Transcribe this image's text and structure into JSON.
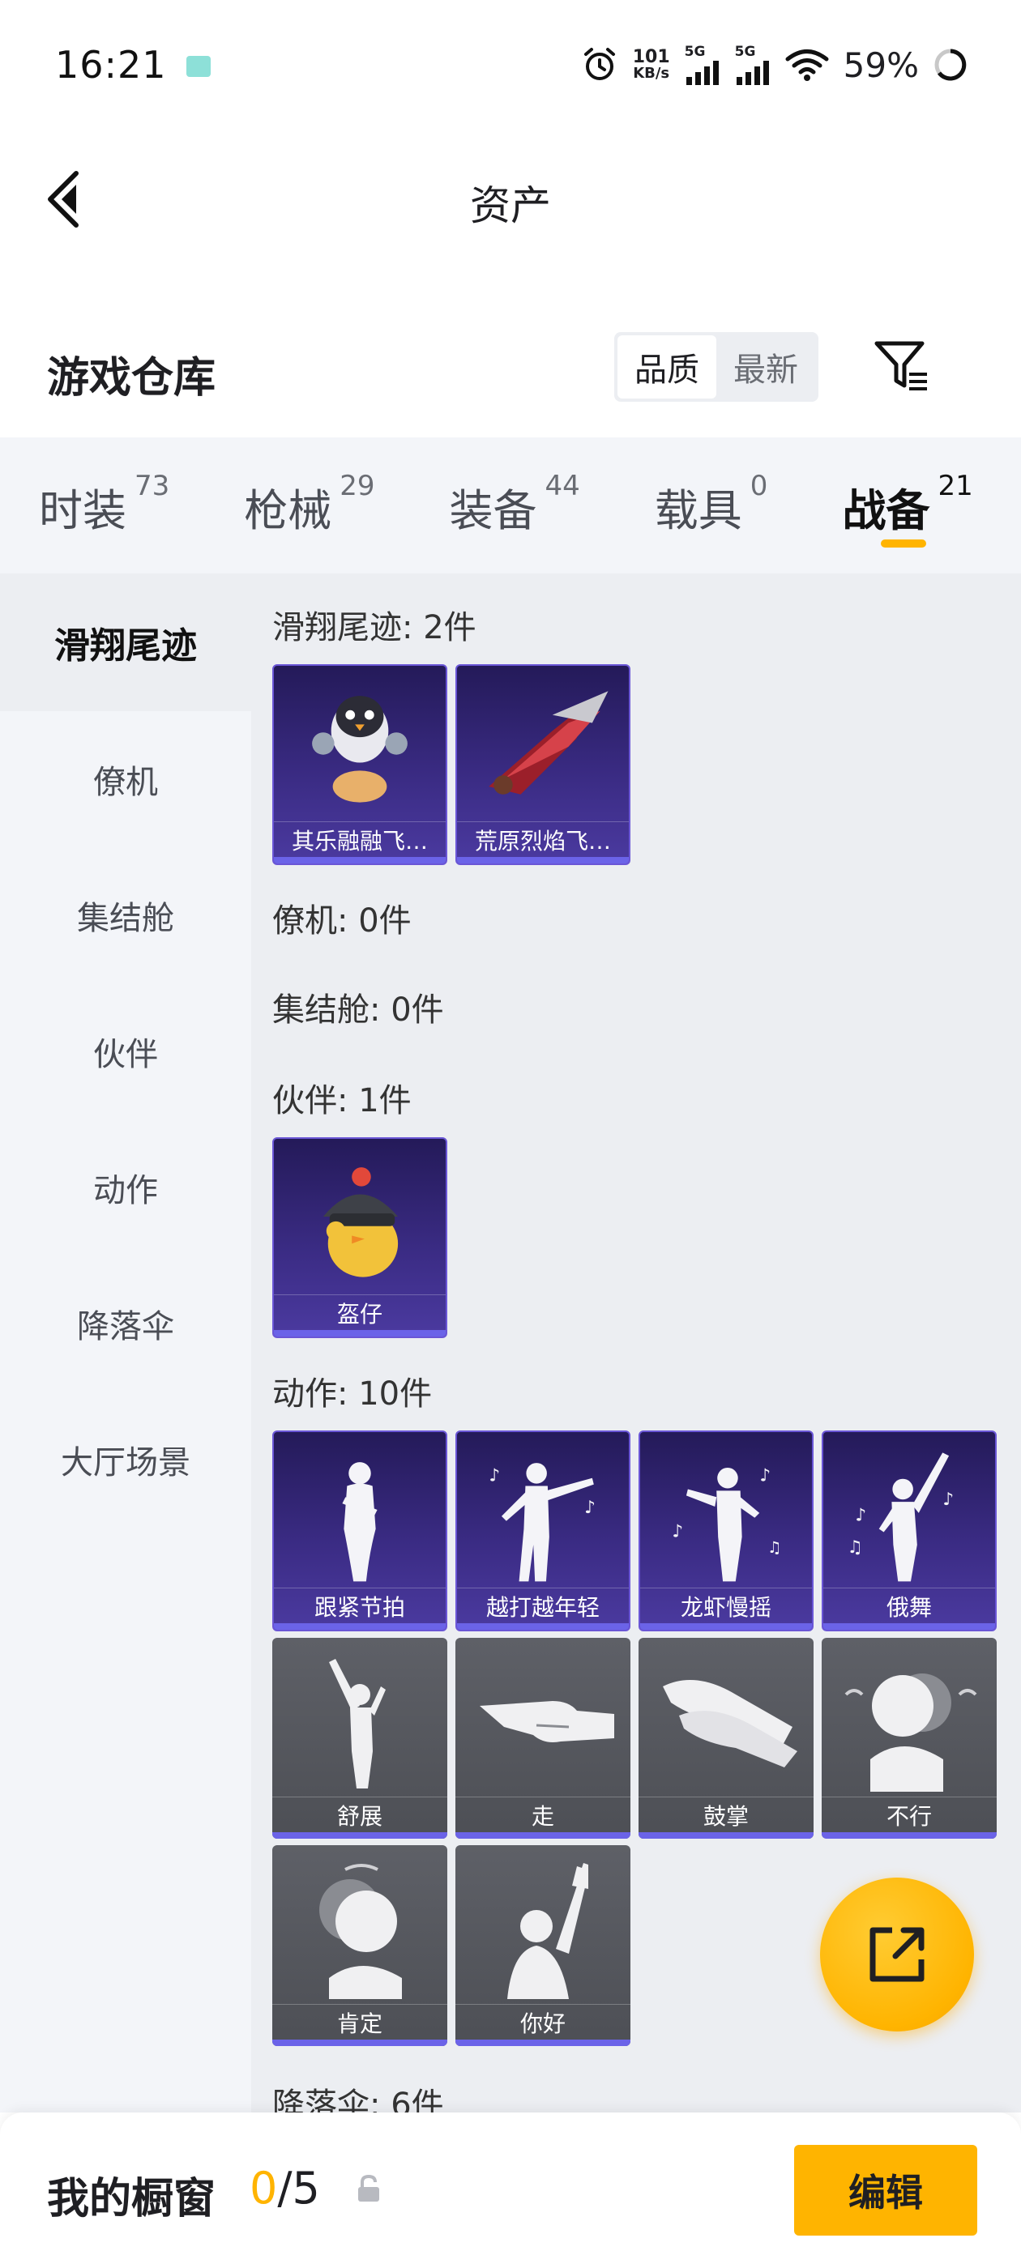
{
  "status_bar": {
    "time": "16:21",
    "net_speed_value": "101",
    "net_speed_unit": "KB/s",
    "signal1_label": "5G",
    "signal2_label": "5G",
    "battery": "59%"
  },
  "header": {
    "title": "资产"
  },
  "warehouse": {
    "title": "游戏仓库",
    "sort_options": [
      "品质",
      "最新"
    ],
    "sort_active": "品质"
  },
  "tabs": [
    {
      "label": "时装",
      "count": "73"
    },
    {
      "label": "枪械",
      "count": "29"
    },
    {
      "label": "装备",
      "count": "44"
    },
    {
      "label": "载具",
      "count": "0"
    },
    {
      "label": "战备",
      "count": "21",
      "active": true
    }
  ],
  "side_nav": [
    {
      "label": "滑翔尾迹",
      "active": true
    },
    {
      "label": "僚机"
    },
    {
      "label": "集结舱"
    },
    {
      "label": "伙伴"
    },
    {
      "label": "动作"
    },
    {
      "label": "降落伞"
    },
    {
      "label": "大厅场景"
    }
  ],
  "sections": {
    "glide_trail": {
      "title": "滑翔尾迹: 2件",
      "items": [
        "其乐融融飞…",
        "荒原烈焰飞…"
      ]
    },
    "wingman": {
      "title": "僚机: 0件"
    },
    "assembly_pod": {
      "title": "集结舱: 0件"
    },
    "companion": {
      "title": "伙伴: 1件",
      "items": [
        "盔仔"
      ]
    },
    "emote": {
      "title": "动作: 10件",
      "items": [
        "跟紧节拍",
        "越打越年轻",
        "龙虾慢摇",
        "俄舞",
        "舒展",
        "走",
        "鼓掌",
        "不行",
        "肯定",
        "你好"
      ]
    },
    "parachute": {
      "title": "降落伞: 6件"
    }
  },
  "bottom_bar": {
    "showcase_label": "我的橱窗",
    "showcase_current": "0",
    "showcase_total": "/5",
    "edit_label": "编辑"
  },
  "colors": {
    "accent": "#ffb400",
    "card_purple": "#3a2b83",
    "card_gray": "#55575d",
    "card_bar": "#6b63e8"
  }
}
